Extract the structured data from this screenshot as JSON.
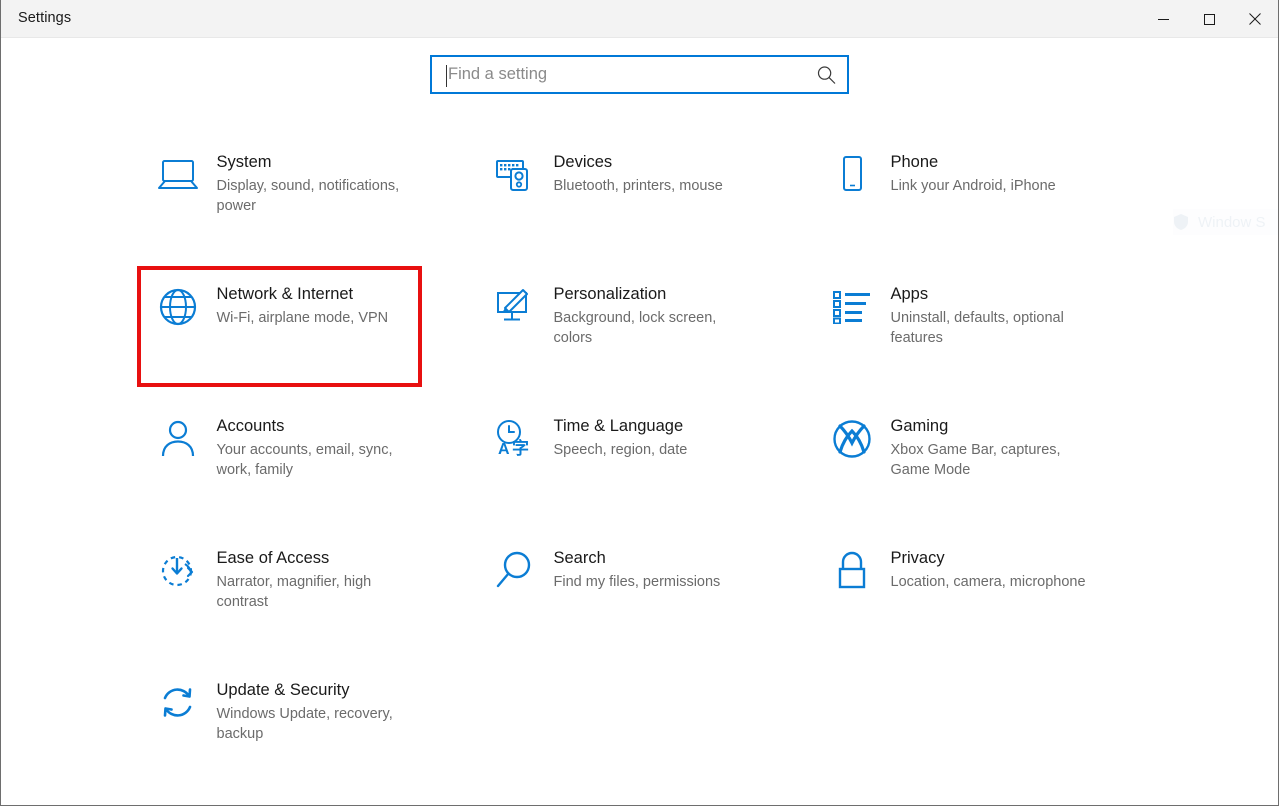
{
  "window": {
    "title": "Settings",
    "controls": [
      {
        "name": "minimize",
        "label": "Minimize"
      },
      {
        "name": "maximize",
        "label": "Maximize"
      },
      {
        "name": "close",
        "label": "Close"
      }
    ]
  },
  "search": {
    "placeholder": "Find a setting",
    "value": "",
    "icon": "search-icon"
  },
  "watermark": {
    "text": "Window S"
  },
  "colors": {
    "accent": "#0078d7",
    "icon_blue": "#0b7dd4",
    "highlight_red": "#e81010",
    "title_bar": "#f3f3f3",
    "title_text": "#1a1a1a",
    "desc_text": "#6b6b6b"
  },
  "highlighted_item": "Network & Internet",
  "grid": {
    "items": [
      {
        "id": "system",
        "title": "System",
        "desc": "Display, sound, notifications, power",
        "icon": "laptop-icon",
        "highlighted": false
      },
      {
        "id": "devices",
        "title": "Devices",
        "desc": "Bluetooth, printers, mouse",
        "icon": "devices-icon",
        "highlighted": false
      },
      {
        "id": "phone",
        "title": "Phone",
        "desc": "Link your Android, iPhone",
        "icon": "phone-icon",
        "highlighted": false
      },
      {
        "id": "network-internet",
        "title": "Network & Internet",
        "desc": "Wi-Fi, airplane mode, VPN",
        "icon": "globe-icon",
        "highlighted": true
      },
      {
        "id": "personalization",
        "title": "Personalization",
        "desc": "Background, lock screen, colors",
        "icon": "paintbrush-monitor-icon",
        "highlighted": false
      },
      {
        "id": "apps",
        "title": "Apps",
        "desc": "Uninstall, defaults, optional features",
        "icon": "list-icon",
        "highlighted": false
      },
      {
        "id": "accounts",
        "title": "Accounts",
        "desc": "Your accounts, email, sync, work, family",
        "icon": "person-icon",
        "highlighted": false
      },
      {
        "id": "time-language",
        "title": "Time & Language",
        "desc": "Speech, region, date",
        "icon": "clock-language-icon",
        "highlighted": false
      },
      {
        "id": "gaming",
        "title": "Gaming",
        "desc": "Xbox Game Bar, captures, Game Mode",
        "icon": "xbox-icon",
        "highlighted": false
      },
      {
        "id": "ease-of-access",
        "title": "Ease of Access",
        "desc": "Narrator, magnifier, high contrast",
        "icon": "ease-of-access-icon",
        "highlighted": false
      },
      {
        "id": "search",
        "title": "Search",
        "desc": "Find my files, permissions",
        "icon": "magnifier-icon",
        "highlighted": false
      },
      {
        "id": "privacy",
        "title": "Privacy",
        "desc": "Location, camera, microphone",
        "icon": "lock-icon",
        "highlighted": false
      },
      {
        "id": "update-security",
        "title": "Update & Security",
        "desc": "Windows Update, recovery, backup",
        "icon": "refresh-icon",
        "highlighted": false
      }
    ]
  }
}
